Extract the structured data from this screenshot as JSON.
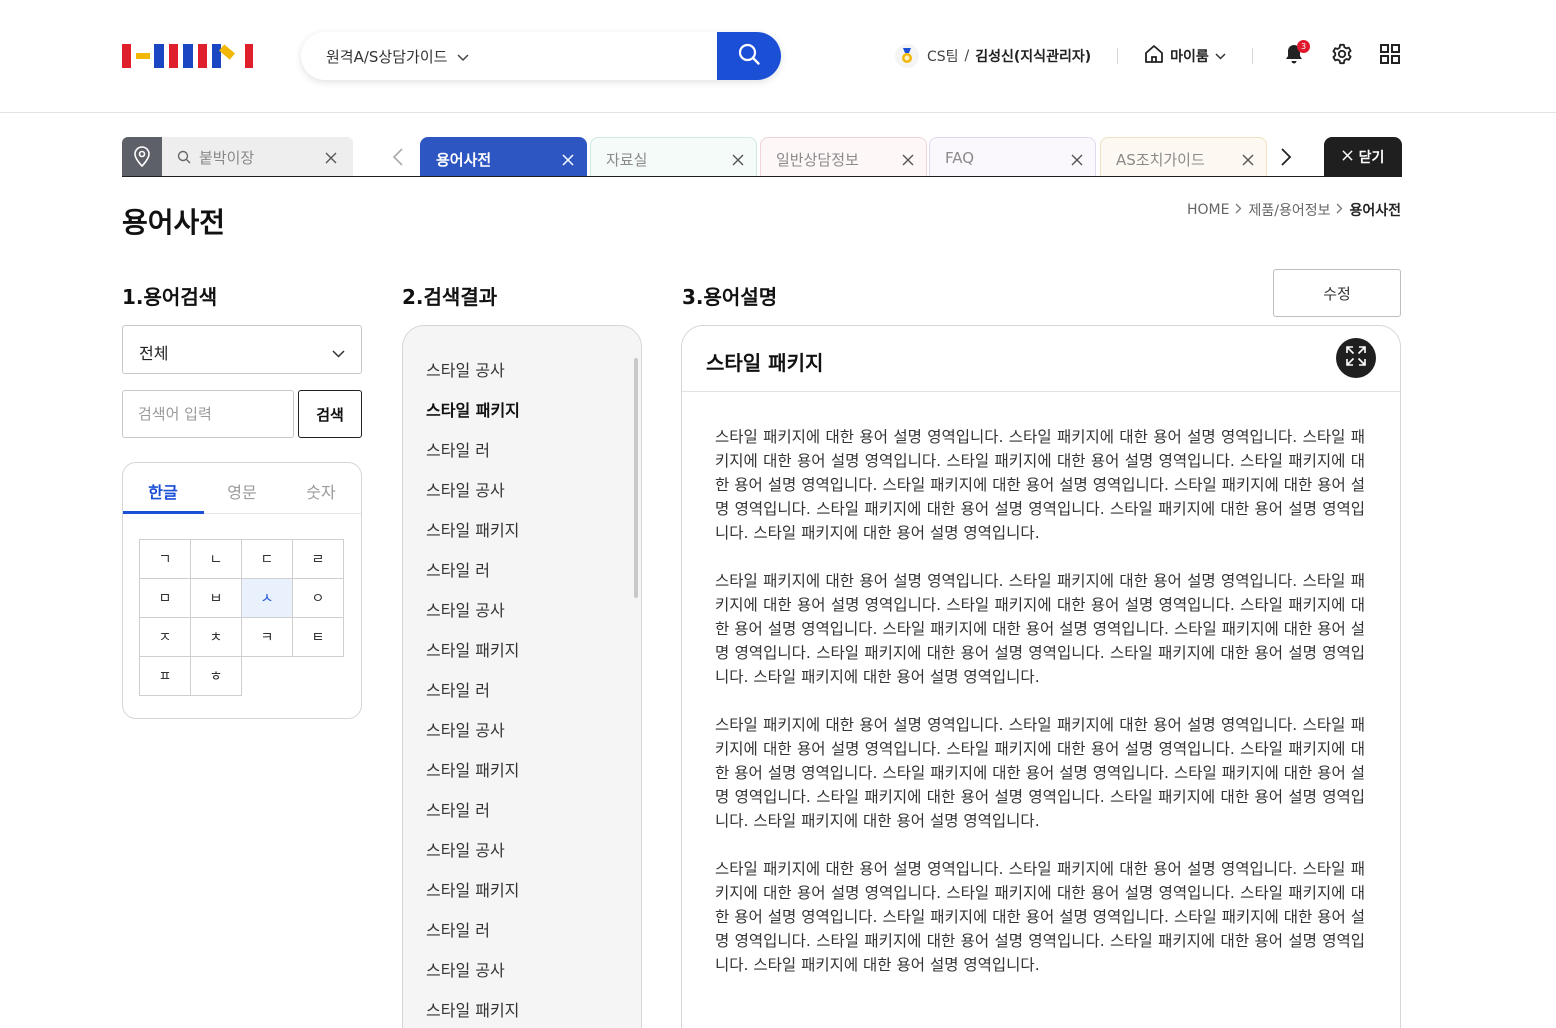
{
  "header": {
    "search_select": "원격A/S상담가이드",
    "user_team": "CS팀",
    "user_separator": "/",
    "user_name": "김성신(지식관리자)",
    "myroom_label": "마이룸",
    "notification_count": "3"
  },
  "location_box": {
    "text": "붙박이장"
  },
  "tabs": [
    {
      "label": "용어사전",
      "active": true
    },
    {
      "label": "자료실",
      "active": false
    },
    {
      "label": "일반상담정보",
      "active": false
    },
    {
      "label": "FAQ",
      "active": false
    },
    {
      "label": "AS조치가이드",
      "active": false
    }
  ],
  "close_all_label": "닫기",
  "page": {
    "title": "용어사전",
    "breadcrumb": [
      "HOME",
      "제품/용어정보",
      "용어사전"
    ]
  },
  "section1": {
    "title": "1.용어검색",
    "category_value": "전체",
    "keyword_placeholder": "검색어 입력",
    "search_button": "검색",
    "index_tabs": [
      "한글",
      "영문",
      "숫자"
    ],
    "consonants": [
      "ㄱ",
      "ㄴ",
      "ㄷ",
      "ㄹ",
      "ㅁ",
      "ㅂ",
      "ㅅ",
      "ㅇ",
      "ㅈ",
      "ㅊ",
      "ㅋ",
      "ㅌ",
      "ㅍ",
      "ㅎ"
    ],
    "selected_consonant": "ㅅ"
  },
  "section2": {
    "title": "2.검색결과",
    "items": [
      "스타일 공사",
      "스타일 패키지",
      "스타일 러",
      "스타일 공사",
      "스타일 패키지",
      "스타일 러",
      "스타일 공사",
      "스타일 패키지",
      "스타일 러",
      "스타일 공사",
      "스타일 패키지",
      "스타일 러",
      "스타일 공사",
      "스타일 패키지",
      "스타일 러",
      "스타일 공사",
      "스타일 패키지"
    ],
    "selected_index": 1
  },
  "section3": {
    "title": "3.용어설명",
    "edit_button": "수정",
    "term_title": "스타일 패키지",
    "paragraphs": [
      "스타일 패키지에 대한 용어 설명  영역입니다. 스타일 패키지에 대한 용어 설명  영역입니다. 스타일 패키지에 대한 용어 설명  영역입니다. 스타일 패키지에 대한 용어 설명  영역입니다. 스타일 패키지에 대한 용어 설명  영역입니다. 스타일 패키지에 대한 용어 설명  영역입니다. 스타일 패키지에 대한 용어 설명  영역입니다. 스타일 패키지에 대한 용어 설명  영역입니다. 스타일 패키지에 대한 용어 설명  영역입니다. 스타일 패키지에 대한 용어 설명  영역입니다.",
      "스타일 패키지에 대한 용어 설명  영역입니다. 스타일 패키지에 대한 용어 설명  영역입니다. 스타일 패키지에 대한 용어 설명  영역입니다. 스타일 패키지에 대한 용어 설명  영역입니다. 스타일 패키지에 대한 용어 설명  영역입니다. 스타일 패키지에 대한 용어 설명  영역입니다. 스타일 패키지에 대한 용어 설명  영역입니다. 스타일 패키지에 대한 용어 설명  영역입니다. 스타일 패키지에 대한 용어 설명  영역입니다. 스타일 패키지에 대한 용어 설명  영역입니다.",
      "스타일 패키지에 대한 용어 설명  영역입니다. 스타일 패키지에 대한 용어 설명  영역입니다. 스타일 패키지에 대한 용어 설명  영역입니다. 스타일 패키지에 대한 용어 설명  영역입니다. 스타일 패키지에 대한 용어 설명  영역입니다. 스타일 패키지에 대한 용어 설명  영역입니다. 스타일 패키지에 대한 용어 설명  영역입니다. 스타일 패키지에 대한 용어 설명  영역입니다. 스타일 패키지에 대한 용어 설명  영역입니다. 스타일 패키지에 대한 용어 설명  영역입니다.",
      "스타일 패키지에 대한 용어 설명  영역입니다. 스타일 패키지에 대한 용어 설명  영역입니다. 스타일 패키지에 대한 용어 설명  영역입니다. 스타일 패키지에 대한 용어 설명  영역입니다. 스타일 패키지에 대한 용어 설명  영역입니다. 스타일 패키지에 대한 용어 설명  영역입니다. 스타일 패키지에 대한 용어 설명  영역입니다. 스타일 패키지에 대한 용어 설명  영역입니다. 스타일 패키지에 대한 용어 설명  영역입니다. 스타일 패키지에 대한 용어 설명  영역입니다."
    ]
  },
  "colors": {
    "accent": "#1a4fd6",
    "active_tab": "#2e56c2",
    "dark": "#1f1f1f"
  },
  "icons": [
    "logo",
    "search-icon",
    "chevron-down-icon",
    "medal-icon",
    "home-icon",
    "bell-icon",
    "gear-icon",
    "grid-icon",
    "location-pin-icon",
    "close-icon",
    "chevron-left-icon",
    "chevron-right-icon",
    "expand-icon"
  ]
}
